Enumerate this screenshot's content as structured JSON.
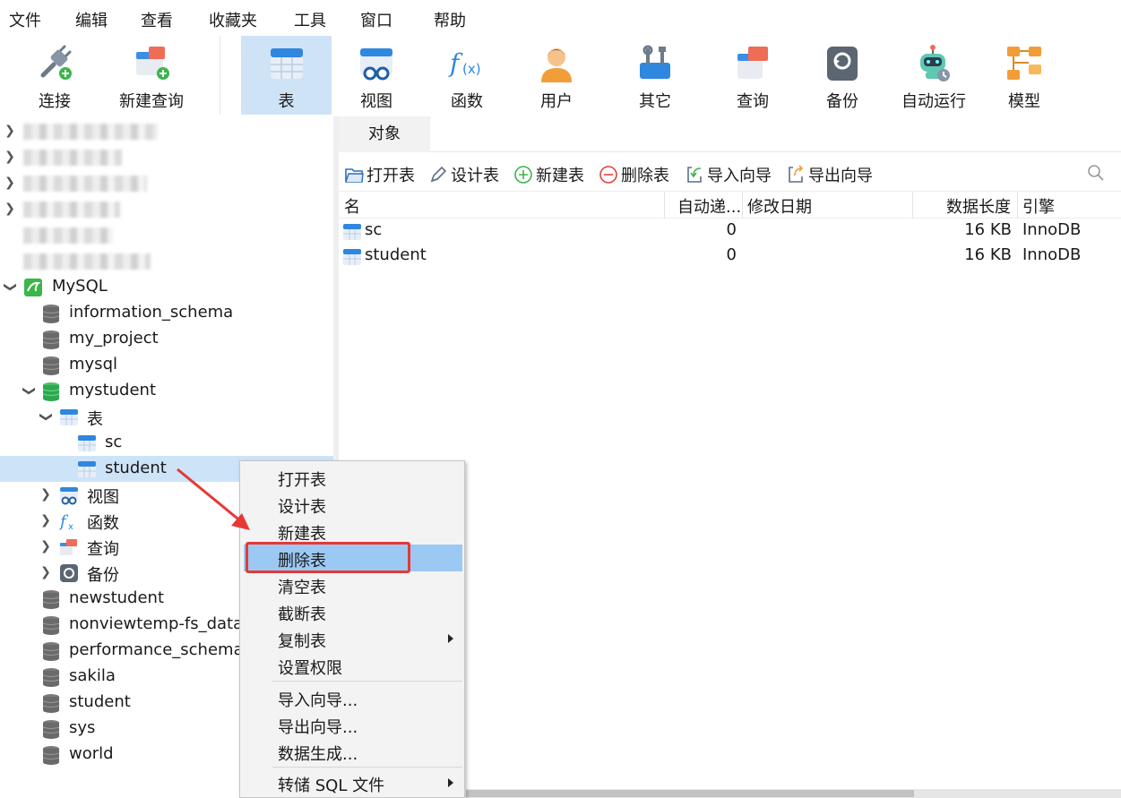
{
  "menubar": [
    "文件",
    "编辑",
    "查看",
    "收藏夹",
    "工具",
    "窗口",
    "帮助"
  ],
  "toolbar": {
    "connect": "连接",
    "new_query": "新建查询",
    "table": "表",
    "view": "视图",
    "function": "函数",
    "user": "用户",
    "other": "其它",
    "query": "查询",
    "backup": "备份",
    "automation": "自动运行",
    "model": "模型"
  },
  "tree": {
    "mysql_label": "MySQL",
    "databases": [
      "information_schema",
      "my_project",
      "mysql",
      "mystudent"
    ],
    "table_group": "表",
    "tables": [
      "sc",
      "student"
    ],
    "view_group": "视图",
    "function_group": "函数",
    "query_group": "查询",
    "backup_group": "备份",
    "more_databases": [
      "newstudent",
      "nonviewtemp-fs_data_",
      "performance_schema",
      "sakila",
      "student",
      "sys",
      "world"
    ]
  },
  "objects_tab": "对象",
  "objbar": {
    "open": "打开表",
    "design": "设计表",
    "new": "新建表",
    "delete": "删除表",
    "import": "导入向导",
    "export": "导出向导"
  },
  "grid": {
    "headers": {
      "name": "名",
      "auto_inc": "自动递...",
      "modified": "修改日期",
      "data_len": "数据长度",
      "engine": "引擎"
    },
    "rows": [
      {
        "name": "sc",
        "auto_inc": "0",
        "data_len": "16 KB",
        "engine": "InnoDB"
      },
      {
        "name": "student",
        "auto_inc": "0",
        "data_len": "16 KB",
        "engine": "InnoDB"
      }
    ]
  },
  "context_menu": {
    "open": "打开表",
    "design": "设计表",
    "new": "新建表",
    "delete": "删除表",
    "empty": "清空表",
    "truncate": "截断表",
    "copy": "复制表",
    "permissions": "设置权限",
    "import": "导入向导...",
    "export": "导出向导...",
    "generate": "数据生成...",
    "dump": "转储 SQL 文件"
  },
  "colors": {
    "accent": "#9cc9f3",
    "selected_row": "#cde3f8",
    "active_tool": "#cfe3f6",
    "highlight_red": "#e53935"
  }
}
